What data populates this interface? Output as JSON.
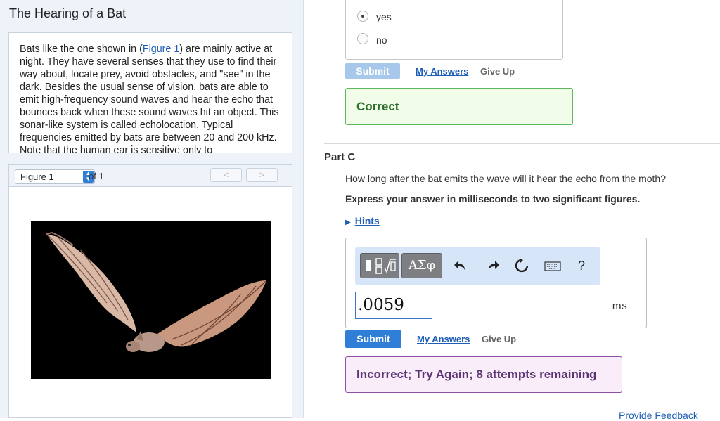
{
  "left": {
    "title": "The Hearing of a Bat",
    "intro": {
      "before_link": "Bats like the one shown in (",
      "link": "Figure 1",
      "after_link": ") are mainly active at night. They have several senses that they use to find their way about, locate prey, avoid obstacles, and \"see\" in the dark. Besides the usual sense of vision, bats are able to emit high-frequency sound waves and hear the echo that bounces back when these sound waves hit an object. This sonar-like system is called echolocation. Typical frequencies emitted by bats are between 20 and 200 kHz. Note that the human ear is sensitive only to"
    },
    "figure": {
      "select_value": "Figure 1",
      "of_text": "of 1",
      "prev_label": "<",
      "next_label": ">"
    }
  },
  "right": {
    "part_b": {
      "options": [
        "yes",
        "no"
      ],
      "selected": "yes",
      "submit_label": "Submit",
      "my_answers_label": "My Answers",
      "give_up_label": "Give Up",
      "feedback": "Correct"
    },
    "part_c": {
      "title": "Part C",
      "question": "How long after the bat emits the wave will it hear the echo from the moth?",
      "instruction": "Express your answer in milliseconds to two significant figures.",
      "hints_label": "Hints",
      "toolbar": {
        "templates_icon": "templates-icon",
        "symbols_label": "ΑΣφ",
        "undo_icon": "undo-icon",
        "redo_icon": "redo-icon",
        "reset_icon": "reset-icon",
        "keyboard_icon": "keyboard-icon",
        "help_label": "?"
      },
      "answer_value": ".0059",
      "unit": "ms",
      "submit_label": "Submit",
      "my_answers_label": "My Answers",
      "give_up_label": "Give Up",
      "feedback": "Incorrect; Try Again; 8 attempts remaining"
    },
    "provide_feedback_label": "Provide Feedback"
  },
  "colors": {
    "link_blue": "#1f5eb8",
    "submit_active": "#2f7fd9",
    "submit_disabled": "#a7c8ea",
    "correct_border": "#5cb85c",
    "correct_bg": "#f2fde9",
    "incorrect_border": "#8e4fa5",
    "incorrect_bg": "#faedfa"
  }
}
